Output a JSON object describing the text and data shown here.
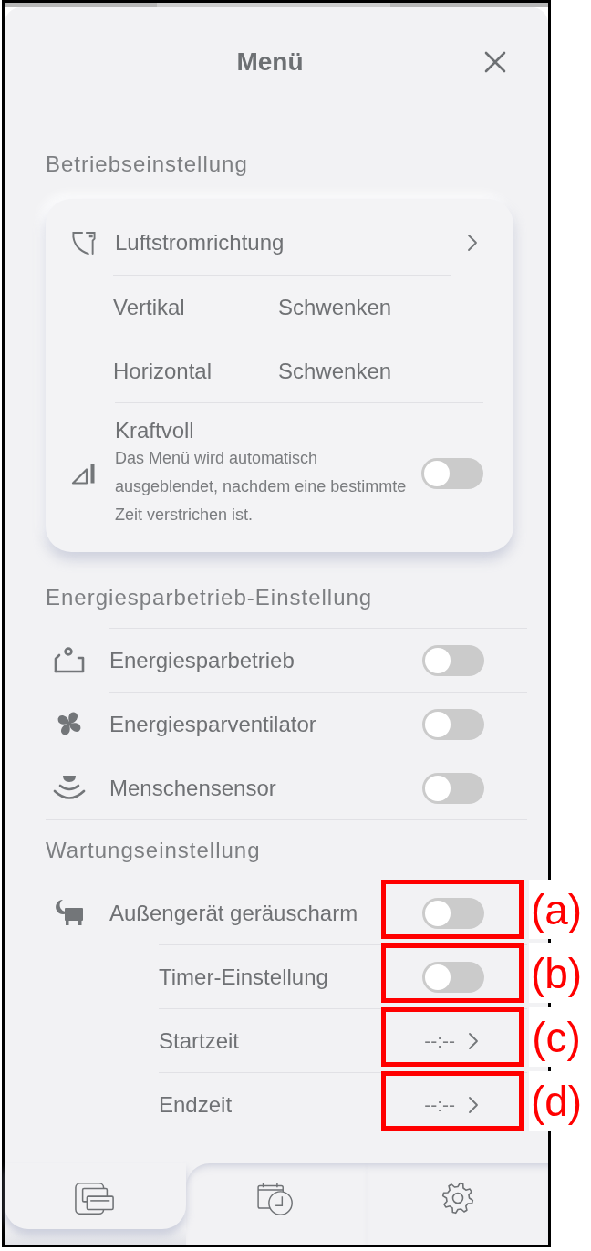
{
  "header": {
    "title": "Menü"
  },
  "sections": [
    {
      "title": "Betriebseinstellung",
      "kind": "card",
      "items": [
        {
          "kind": "link",
          "label": "Luftstromrichtung",
          "children": [
            {
              "label": "Vertikal",
              "value": "Schwenken"
            },
            {
              "label": "Horizontal",
              "value": "Schwenken"
            }
          ]
        },
        {
          "kind": "toggle",
          "label": "Kraftvoll",
          "description": "Das Menü wird automatisch ausgeblendet, nachdem eine bestimmte Zeit verstrichen ist.",
          "on": false
        }
      ]
    },
    {
      "title": "Energiesparbetrieb-Einstellung",
      "kind": "list",
      "items": [
        {
          "kind": "toggle",
          "label": "Energiesparbetrieb",
          "on": false
        },
        {
          "kind": "toggle",
          "label": "Energiesparventilator",
          "on": false
        },
        {
          "kind": "toggle",
          "label": "Menschensensor",
          "on": false
        }
      ]
    },
    {
      "title": "Wartungseinstellung",
      "kind": "list",
      "items": [
        {
          "kind": "toggle",
          "label": "Außengerät geräuscharm",
          "on": false,
          "callout": "(a)",
          "children": [
            {
              "kind": "toggle",
              "label": "Timer-Einstellung",
              "on": false,
              "callout": "(b)"
            },
            {
              "kind": "time",
              "label": "Startzeit",
              "value": "--:--",
              "callout": "(c)"
            },
            {
              "kind": "time",
              "label": "Endzeit",
              "value": "--:--",
              "callout": "(d)"
            }
          ]
        }
      ]
    }
  ],
  "tab_bar": {
    "tabs": [
      {
        "selected": true
      },
      {
        "selected": false
      },
      {
        "selected": false
      }
    ]
  }
}
